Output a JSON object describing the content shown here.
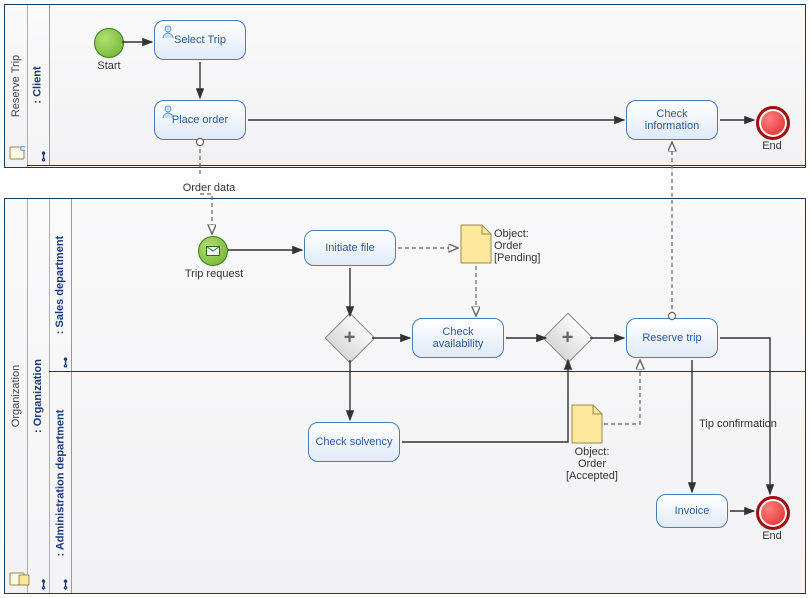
{
  "pool1": {
    "title": "Reserve Trip"
  },
  "pool2": {
    "title": "Organization"
  },
  "lane_client": {
    "title": ": Client"
  },
  "lane_org": {
    "title": ": Organization"
  },
  "lane_sales": {
    "title": ": Sales department"
  },
  "lane_admin": {
    "title": ": Administration department"
  },
  "start1_label": "Start",
  "end1_label": "End",
  "end2_label": "End",
  "task_select": "Select Trip",
  "task_place": "Place order",
  "task_checkinfo": "Check information",
  "task_initiate": "Initiate file",
  "task_checkavail": "Check availability",
  "task_checksolv": "Check solvency",
  "task_reserve": "Reserve trip",
  "task_invoice": "Invoice",
  "trip_request_label": "Trip request",
  "order_data_label": "Order data",
  "tip_conf_label": "Tip confirmation",
  "obj_pending": "Object:\nOrder\n[Pending]",
  "obj_accepted": "Object:\nOrder\n[Accepted]"
}
